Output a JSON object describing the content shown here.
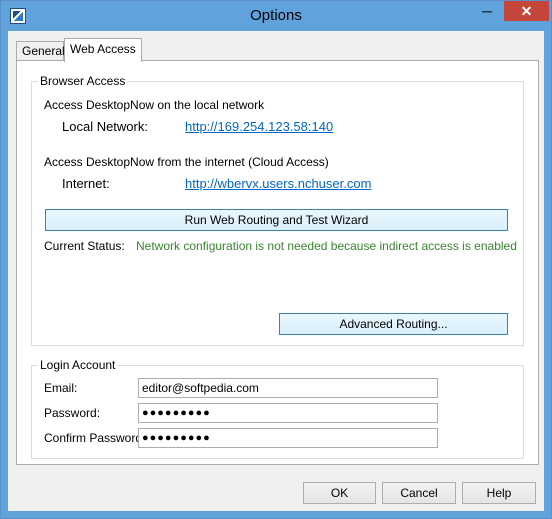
{
  "window": {
    "title": "Options",
    "minimize": "─",
    "close": "✕"
  },
  "tabs": [
    "General",
    "Web Access"
  ],
  "browser_access": {
    "group_label": "Browser Access",
    "local_heading": "Access DesktopNow on the local network",
    "local_label": "Local Network:",
    "local_url": "http://169.254.123.58:140",
    "internet_heading": "Access DesktopNow from the internet (Cloud Access)",
    "internet_label": "Internet:",
    "internet_url": "http://wbervx.users.nchuser.com",
    "wizard_button": "Run Web Routing and Test Wizard",
    "status_label": "Current Status:",
    "status_text": "Network configuration is not needed because indirect access is enabled",
    "advanced_button": "Advanced Routing..."
  },
  "login": {
    "group_label": "Login Account",
    "email_label": "Email:",
    "email_value": "editor@softpedia.com",
    "password_label": "Password:",
    "password_value": "●●●●●●●●●",
    "confirm_label": "Confirm Password:",
    "confirm_value": "●●●●●●●●●"
  },
  "footer": {
    "ok": "OK",
    "cancel": "Cancel",
    "help": "Help"
  }
}
